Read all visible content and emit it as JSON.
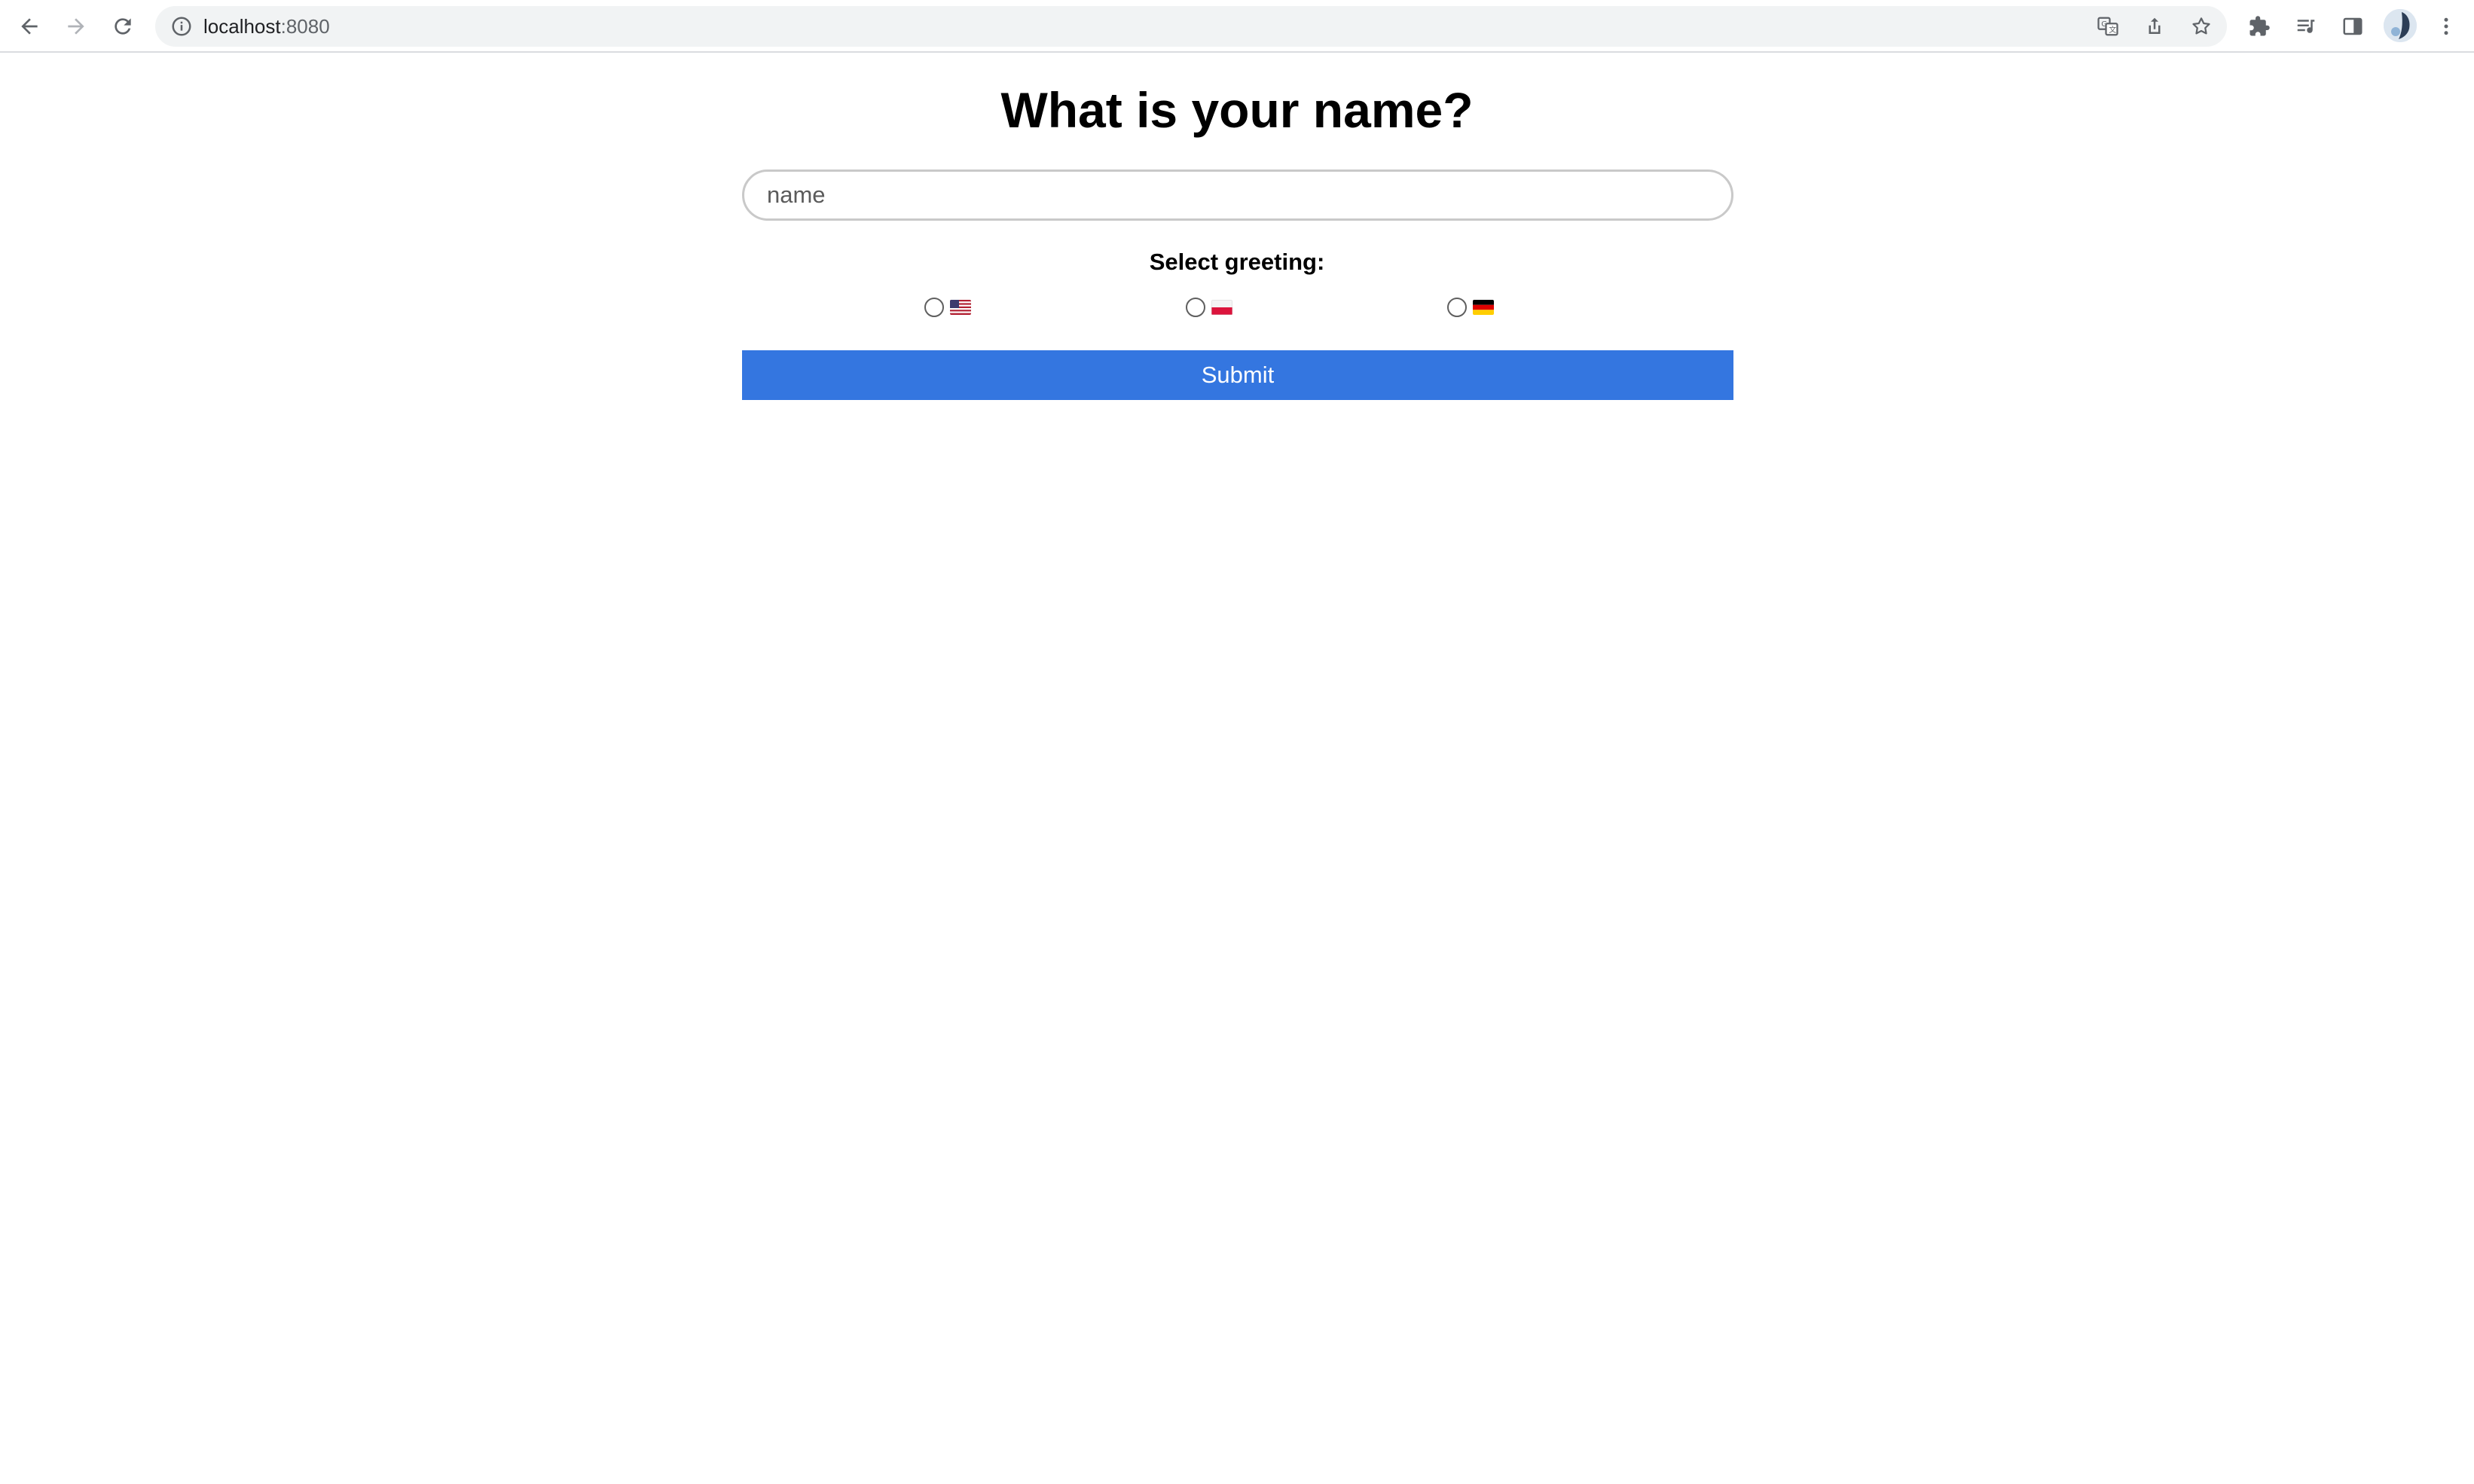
{
  "browser": {
    "url_host": "localhost",
    "url_port": ":8080"
  },
  "page": {
    "title": "What is your name?",
    "name_input": {
      "placeholder": "name",
      "value": ""
    },
    "greeting_label": "Select greeting:",
    "greetings": [
      {
        "flag": "us-flag-icon",
        "selected": false
      },
      {
        "flag": "poland-flag-icon",
        "selected": false
      },
      {
        "flag": "germany-flag-icon",
        "selected": false
      }
    ],
    "submit_label": "Submit"
  },
  "colors": {
    "submit_bg": "#3476e0",
    "page_bg": "#ffffff"
  }
}
